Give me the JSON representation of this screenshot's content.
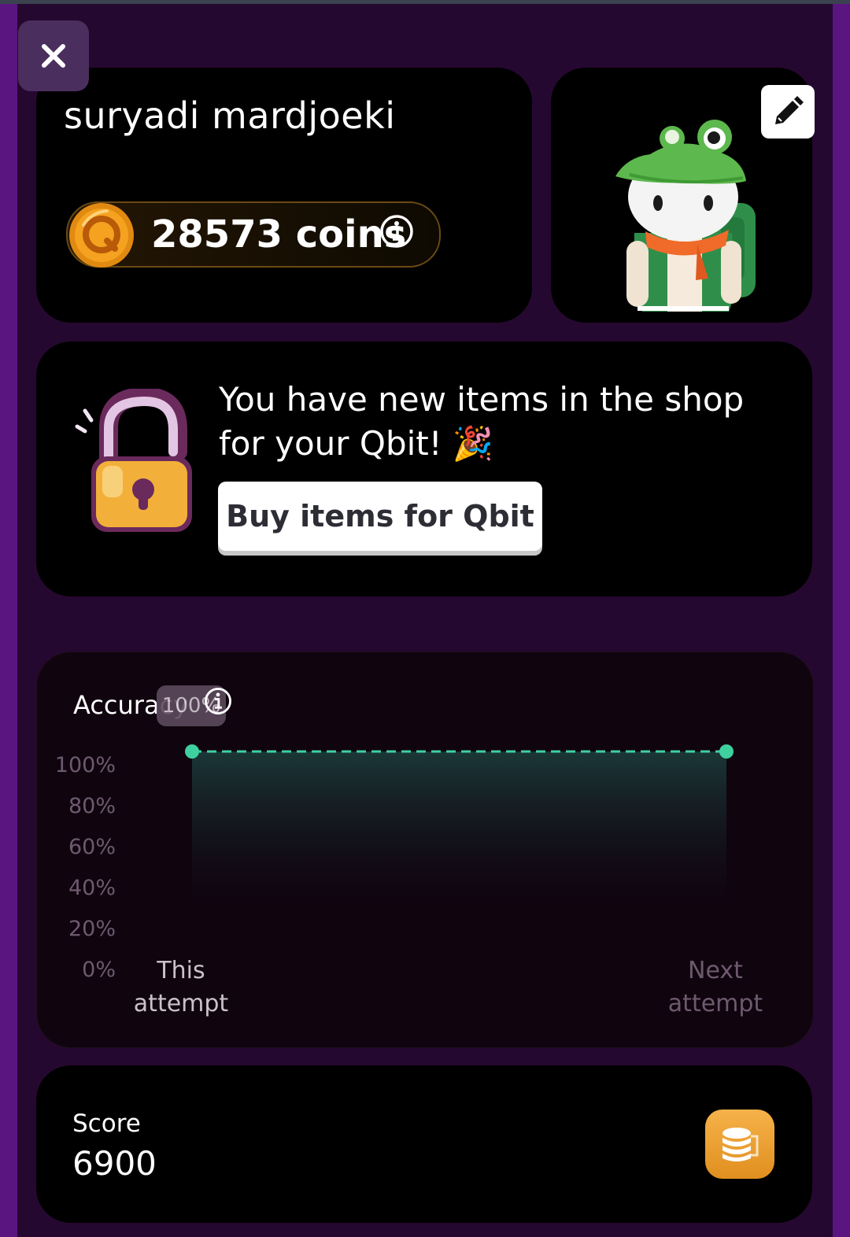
{
  "profile": {
    "name": "suryadi mardjoeki",
    "coins": "28573 coins"
  },
  "shop": {
    "message": "You have new items in the shop for your Qbit! 🎉",
    "button_label": "Buy items for Qbit"
  },
  "chart_data": {
    "type": "area",
    "title": "Accuracy",
    "badge": "100%",
    "y_ticks": [
      "100%",
      "80%",
      "60%",
      "40%",
      "20%",
      "0%"
    ],
    "categories": [
      "This attempt",
      "Next attempt"
    ],
    "values": [
      100,
      100
    ],
    "ylim": [
      0,
      100
    ],
    "colors": {
      "line": "#3fd0a0",
      "fill": "#1b3a3a"
    }
  },
  "score": {
    "label": "Score",
    "value": "6900"
  },
  "icons": [
    "close-icon",
    "coin-icon",
    "info-icon",
    "pencil-icon",
    "padlock-icon",
    "coins-stack-icon"
  ]
}
